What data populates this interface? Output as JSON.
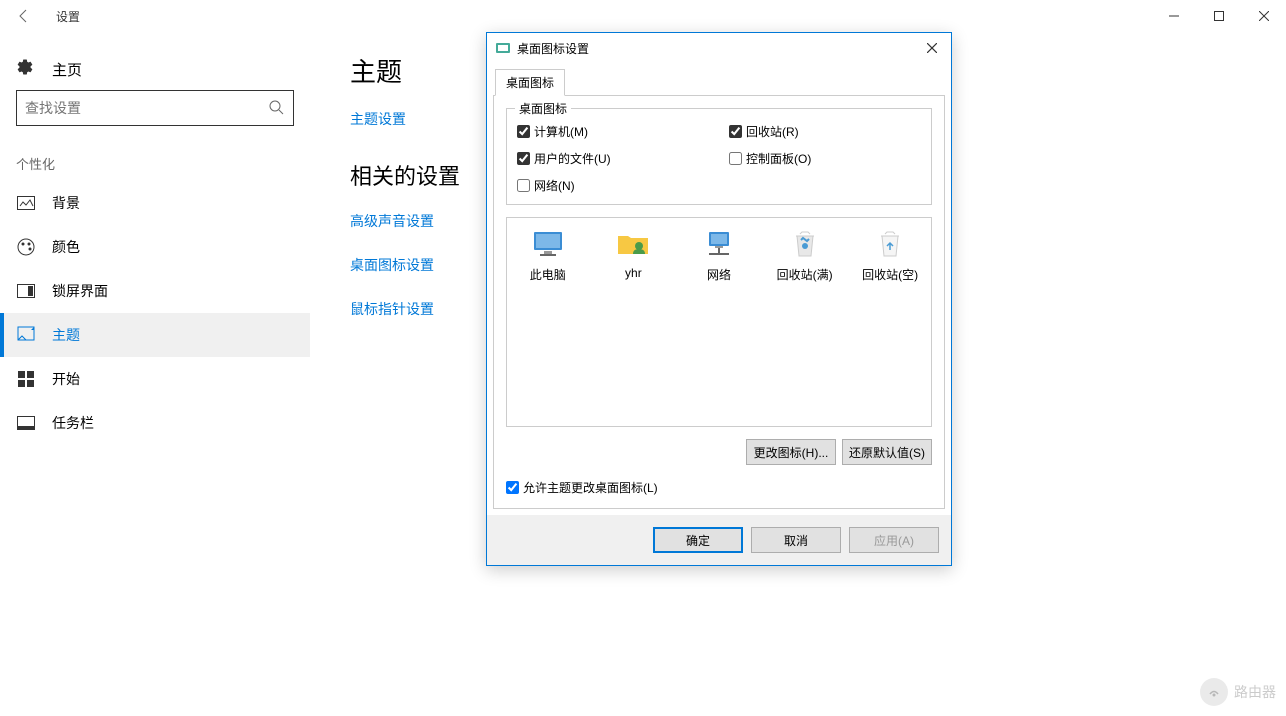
{
  "window": {
    "title": "设置"
  },
  "sidebar": {
    "home": "主页",
    "search_placeholder": "查找设置",
    "category": "个性化",
    "items": [
      {
        "label": "背景"
      },
      {
        "label": "颜色"
      },
      {
        "label": "锁屏界面"
      },
      {
        "label": "主题"
      },
      {
        "label": "开始"
      },
      {
        "label": "任务栏"
      }
    ]
  },
  "content": {
    "heading1": "主题",
    "link1": "主题设置",
    "heading2": "相关的设置",
    "links": [
      "高级声音设置",
      "桌面图标设置",
      "鼠标指针设置"
    ]
  },
  "dialog": {
    "title": "桌面图标设置",
    "tab": "桌面图标",
    "groupbox_title": "桌面图标",
    "checkboxes": [
      {
        "label": "计算机(M)",
        "checked": true
      },
      {
        "label": "回收站(R)",
        "checked": true
      },
      {
        "label": "用户的文件(U)",
        "checked": true
      },
      {
        "label": "控制面板(O)",
        "checked": false
      },
      {
        "label": "网络(N)",
        "checked": false
      }
    ],
    "preview_icons": [
      {
        "label": "此电脑"
      },
      {
        "label": "yhr"
      },
      {
        "label": "网络"
      },
      {
        "label": "回收站(满)"
      },
      {
        "label": "回收站(空)"
      }
    ],
    "change_icon_btn": "更改图标(H)...",
    "restore_btn": "还原默认值(S)",
    "allow_theme_check": "允许主题更改桌面图标(L)",
    "ok_btn": "确定",
    "cancel_btn": "取消",
    "apply_btn": "应用(A)"
  },
  "watermark": {
    "text": "路由器"
  }
}
